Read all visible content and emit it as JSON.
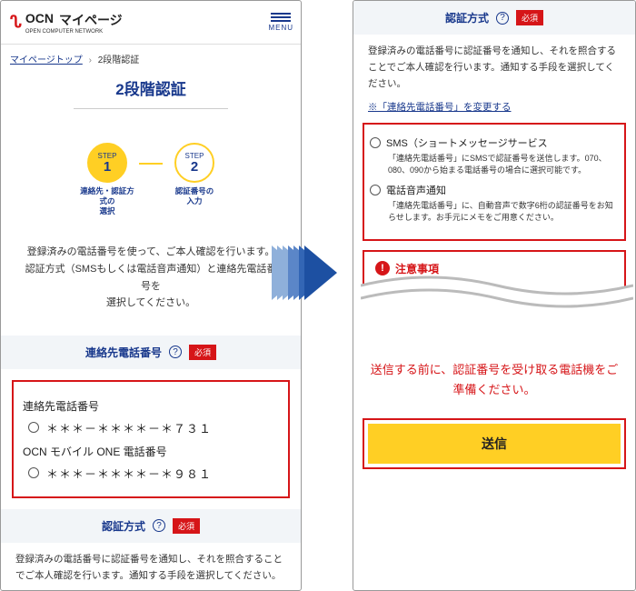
{
  "header": {
    "brand": "OCN",
    "page": "マイページ",
    "menu": "MENU"
  },
  "breadcrumb": {
    "top": "マイページトップ",
    "current": "2段階認証"
  },
  "title": "2段階認証",
  "steps": {
    "tag": "STEP",
    "s1": {
      "n": "1",
      "label": "連絡先・認証方\n式の\n選択"
    },
    "s2": {
      "n": "2",
      "label": "認証番号の\n入力"
    }
  },
  "explain": "登録済みの電話番号を使って、ご本人確認を行います。\n認証方式（SMSもしくは電話音声通知）と連絡先電話番号を\n選択してください。",
  "sect_phone": "連絡先電話番号",
  "sect_method": "認証方式",
  "required": "必須",
  "phone": {
    "label1": "連絡先電話番号",
    "num1": "＊＊＊－＊＊＊＊－＊７３１",
    "label2": "OCN モバイル ONE 電話番号",
    "num2": "＊＊＊－＊＊＊＊－＊９８１"
  },
  "method_para": "登録済みの電話番号に認証番号を通知し、それを照合することでご本人確認を行います。通知する手段を選択してください。",
  "change_link": "※「連絡先電話番号」を変更する",
  "opts": {
    "sms": {
      "t": "SMS（ショートメッセージサービス",
      "d": "「連絡先電話番号」にSMSで認証番号を送信します。070、080、090から始まる電話番号の場合に選択可能です。"
    },
    "voice": {
      "t": "電話音声通知",
      "d": "「連絡先電話番号」に、自動音声で数字6桁の認証番号をお知らせします。お手元にメモをご用意ください。"
    }
  },
  "warn": {
    "title": "注意事項"
  },
  "presend": "送信する前に、認証番号を受け取る電話機をご準備ください。",
  "submit": "送信"
}
